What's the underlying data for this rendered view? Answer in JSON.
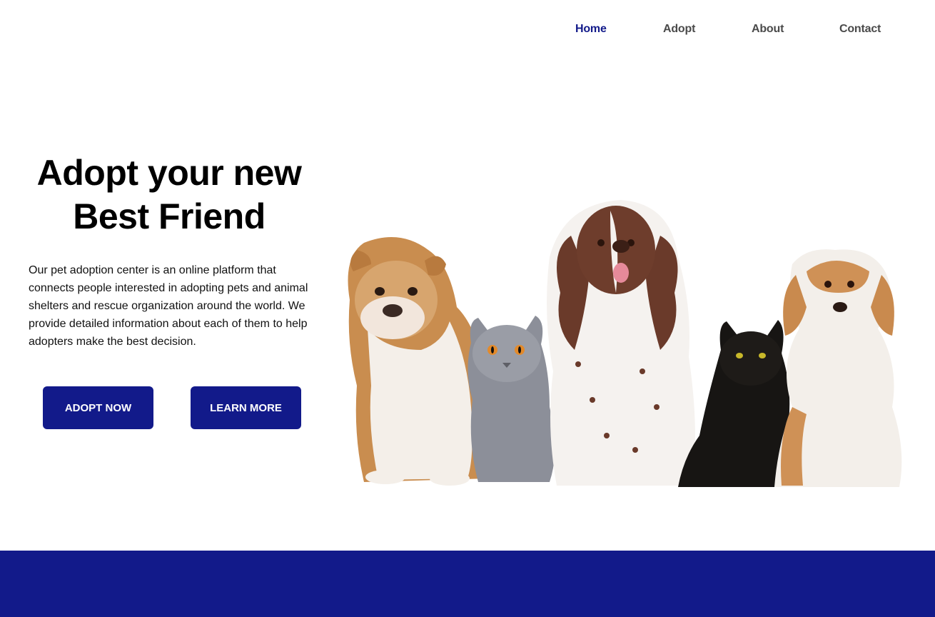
{
  "nav": {
    "items": [
      {
        "label": "Home",
        "active": true
      },
      {
        "label": "Adopt",
        "active": false
      },
      {
        "label": "About",
        "active": false
      },
      {
        "label": "Contact",
        "active": false
      }
    ]
  },
  "hero": {
    "title_line1": "Adopt your new",
    "title_line2": "Best Friend",
    "description": "Our pet adoption center is an online platform that connects people interested in adopting pets and animal shelters and rescue organization around the world. We provide detailed information about each of them to help adopters make the best decision.",
    "buttons": {
      "adopt_now": "ADOPT NOW",
      "learn_more": "LEARN MORE"
    },
    "image_subject": "group of dogs and cats: bulldog, gray cat, spaniel, black cat, beagle"
  },
  "colors": {
    "brand": "#121a8a",
    "nav_inactive": "#4a4a4a",
    "background": "#ffffff"
  }
}
